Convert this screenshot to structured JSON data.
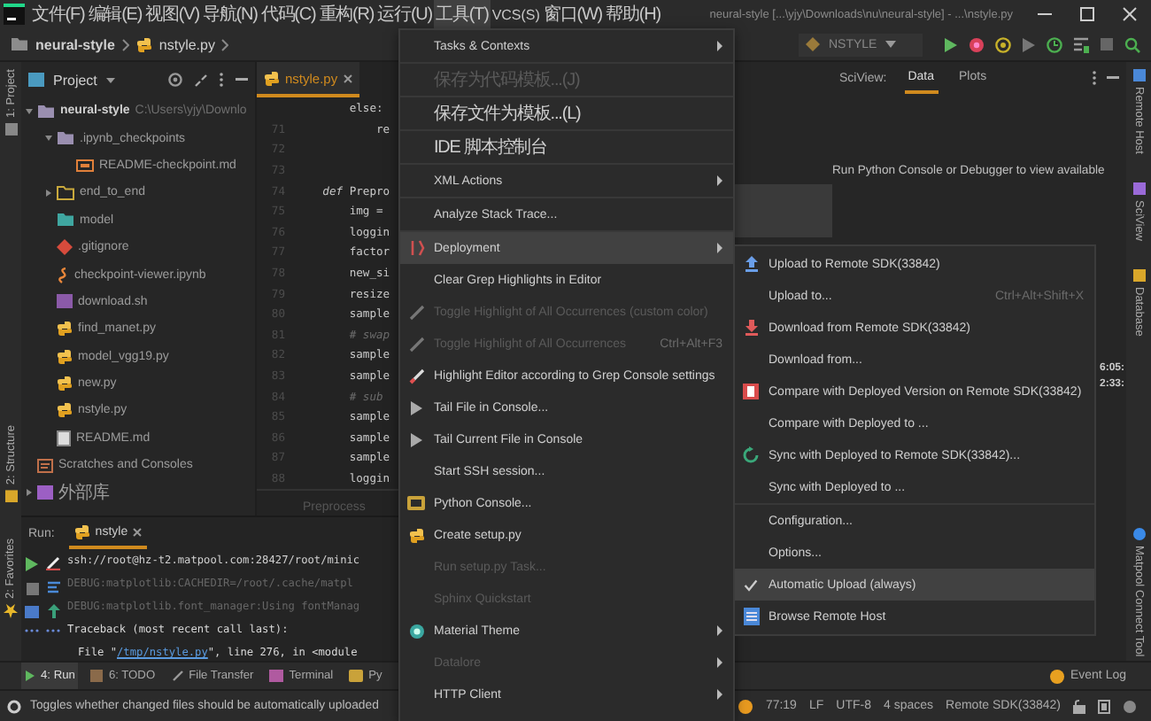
{
  "menu_bar": {
    "items": [
      {
        "label": "文件(F)",
        "selected": false
      },
      {
        "label": "编辑(E)",
        "selected": false
      },
      {
        "label": "视图(V)",
        "selected": false
      },
      {
        "label": "导航(N)",
        "selected": false
      },
      {
        "label": "代码(C)",
        "selected": false
      },
      {
        "label": "重构(R)",
        "selected": false
      },
      {
        "label": "运行(U)",
        "selected": false
      },
      {
        "label": "工具(T)",
        "selected": true
      },
      {
        "label": "VCS(S)",
        "selected": false
      },
      {
        "label": "窗口(W)",
        "selected": false
      },
      {
        "label": "帮助(H)",
        "selected": false
      }
    ],
    "title": "neural-style [...\\yjy\\Downloads\\nu\\neural-style] - ...\\nstyle.py"
  },
  "breadcrumb": [
    "neural-style",
    "nstyle.py"
  ],
  "run_config": "NSTYLE",
  "left_stripe": [
    "1: Project",
    "2: Structure",
    "2: Favorites"
  ],
  "project_panel": {
    "title": "Project",
    "tree": [
      {
        "label": "neural-style",
        "path": "C:\\Users\\yjy\\Downlo",
        "kind": "folder",
        "expanded": true,
        "children": [
          {
            "label": ".ipynb_checkpoints",
            "kind": "folder",
            "expanded": true,
            "children": [
              {
                "label": "README-checkpoint.md",
                "kind": "md"
              }
            ]
          },
          {
            "label": "end_to_end",
            "kind": "package",
            "expanded": false
          },
          {
            "label": "model",
            "kind": "module"
          },
          {
            "label": ".gitignore",
            "kind": "git"
          },
          {
            "label": "checkpoint-viewer.ipynb",
            "kind": "ipynb"
          },
          {
            "label": "download.sh",
            "kind": "sh"
          },
          {
            "label": "find_manet.py",
            "kind": "py"
          },
          {
            "label": "model_vgg19.py",
            "kind": "py"
          },
          {
            "label": "new.py",
            "kind": "py"
          },
          {
            "label": "nstyle.py",
            "kind": "py"
          },
          {
            "label": "README.md",
            "kind": "doc"
          }
        ]
      },
      {
        "label": "Scratches and Consoles",
        "kind": "scratch"
      },
      {
        "label": "外部库",
        "kind": "library",
        "expanded": false
      }
    ]
  },
  "editor": {
    "tab": "nstyle.py",
    "lines": [
      {
        "code": "        else:",
        "kind": "code"
      },
      {
        "number": "71",
        "code": "            re",
        "kind": "code"
      },
      {
        "number": "72"
      },
      {
        "number": "73"
      },
      {
        "number": "74",
        "code": "    *def* Prepro",
        "kind": "code"
      },
      {
        "number": "75",
        "code": "        img =",
        "kind": "code"
      },
      {
        "number": "76",
        "code": "        loggin",
        "kind": "code"
      },
      {
        "number": "77",
        "code": "        factor",
        "kind": "code"
      },
      {
        "number": "78",
        "code": "        new_si",
        "kind": "code"
      },
      {
        "number": "79",
        "code": "        resize",
        "kind": "code"
      },
      {
        "number": "80",
        "code": "        sample",
        "kind": "code"
      },
      {
        "number": "81",
        "code": "        # swap",
        "kind": "comment"
      },
      {
        "number": "82",
        "code": "        sample",
        "kind": "code"
      },
      {
        "number": "83",
        "code": "        sample",
        "kind": "code"
      },
      {
        "number": "84",
        "code": "        # sub",
        "kind": "comment"
      },
      {
        "number": "85",
        "code": "        sample",
        "kind": "code"
      },
      {
        "number": "86",
        "code": "        sample",
        "kind": "code"
      },
      {
        "number": "87",
        "code": "        sample",
        "kind": "code"
      },
      {
        "number": "88",
        "code": "        loggin",
        "kind": "code"
      }
    ],
    "footer": "Preprocess"
  },
  "sciview": {
    "label": "SciView:",
    "tabs": [
      {
        "label": "Data",
        "selected": true
      },
      {
        "label": "Plots",
        "selected": false
      }
    ],
    "message": "Run Python Console or Debugger to view available"
  },
  "log_times": [
    "6:05:",
    "2:33:"
  ],
  "right_stripe": [
    "Remote Host",
    "SciView",
    "Database",
    "Matpool Connect Tool"
  ],
  "run_panel": {
    "label": "Run:",
    "tab": "nstyle",
    "lines": [
      {
        "kind": "command",
        "text": "ssh://root@hz-t2.matpool.com:28427/root/minic"
      },
      {
        "kind": "debug",
        "text": "DEBUG:matplotlib:CACHEDIR=/root/.cache/matpl"
      },
      {
        "kind": "debug",
        "text": "DEBUG:matplotlib.font_manager:Using fontManag"
      },
      {
        "kind": "error",
        "text": "Traceback (most recent call last):"
      },
      {
        "kind": "trace",
        "before": "File \"",
        "link": "/tmp/nstyle.py",
        "after": "\", line 276, in <module"
      }
    ]
  },
  "bottom_tabs": [
    {
      "label": "4: Run",
      "selected": true
    },
    {
      "label": "6: TODO",
      "selected": false
    },
    {
      "label": "File Transfer",
      "selected": false
    },
    {
      "label": "Terminal",
      "selected": false
    },
    {
      "label": "Py",
      "selected": false
    }
  ],
  "event_log": "Event Log",
  "status_bar": {
    "message": "Toggles whether changed files should be automatically uploaded",
    "items": [
      "77:19",
      "LF",
      "UTF-8",
      "4 spaces",
      "Remote SDK(33842)"
    ]
  },
  "tools_menu": [
    {
      "label": "Tasks & Contexts",
      "selected": false,
      "disabled": false,
      "submenu": true,
      "separator_before": false
    },
    {
      "label": "保存为代码模板...(J)",
      "selected": false,
      "disabled": true,
      "submenu": false,
      "separator_before": true
    },
    {
      "label": "保存文件为模板...(L)",
      "selected": false,
      "disabled": false,
      "submenu": false,
      "separator_before": true
    },
    {
      "label": "IDE 脚本控制台",
      "selected": false,
      "disabled": false,
      "submenu": false,
      "separator_before": true
    },
    {
      "label": "XML Actions",
      "selected": false,
      "disabled": false,
      "submenu": true,
      "separator_before": true
    },
    {
      "label": "Analyze Stack Trace...",
      "selected": false,
      "disabled": false,
      "submenu": false,
      "separator_before": true
    },
    {
      "label": "Deployment",
      "selected": true,
      "disabled": false,
      "submenu": true,
      "separator_before": true
    },
    {
      "label": "Clear Grep Highlights in Editor",
      "selected": false,
      "disabled": false,
      "submenu": false,
      "separator_before": false
    },
    {
      "label": "Toggle Highlight of All Occurrences (custom color)",
      "selected": false,
      "disabled": true,
      "submenu": false,
      "separator_before": false
    },
    {
      "label": "Toggle Highlight of All Occurrences",
      "shortcut": "Ctrl+Alt+F3",
      "selected": false,
      "disabled": true,
      "submenu": false,
      "separator_before": false
    },
    {
      "label": "Highlight Editor according to Grep Console settings",
      "selected": false,
      "disabled": false,
      "submenu": false,
      "separator_before": false
    },
    {
      "label": "Tail File in Console...",
      "selected": false,
      "disabled": false,
      "submenu": false,
      "separator_before": false
    },
    {
      "label": "Tail Current File in Console",
      "selected": false,
      "disabled": false,
      "submenu": false,
      "separator_before": false
    },
    {
      "label": "Start SSH session...",
      "selected": false,
      "disabled": false,
      "submenu": false,
      "separator_before": false
    },
    {
      "label": "Python Console...",
      "selected": false,
      "disabled": false,
      "submenu": false,
      "separator_before": false
    },
    {
      "label": "Create setup.py",
      "selected": false,
      "disabled": false,
      "submenu": false,
      "separator_before": false
    },
    {
      "label": "Run setup.py Task...",
      "selected": false,
      "disabled": true,
      "submenu": false,
      "separator_before": false
    },
    {
      "label": "Sphinx Quickstart",
      "selected": false,
      "disabled": true,
      "submenu": false,
      "separator_before": false
    },
    {
      "label": "Material Theme",
      "selected": false,
      "disabled": false,
      "submenu": true,
      "separator_before": false
    },
    {
      "label": "Datalore",
      "selected": false,
      "disabled": true,
      "submenu": true,
      "separator_before": false
    },
    {
      "label": "HTTP Client",
      "selected": false,
      "disabled": false,
      "submenu": true,
      "separator_before": false
    }
  ],
  "deployment_menu": [
    {
      "label": "Upload to Remote SDK(33842)",
      "selected": false,
      "checked": false,
      "separator_before": false
    },
    {
      "label": "Upload to...",
      "shortcut": "Ctrl+Alt+Shift+X",
      "selected": false,
      "checked": false,
      "separator_before": false
    },
    {
      "label": "Download from Remote SDK(33842)",
      "selected": false,
      "checked": false,
      "separator_before": false
    },
    {
      "label": "Download from...",
      "selected": false,
      "checked": false,
      "separator_before": false
    },
    {
      "label": "Compare with Deployed Version on Remote SDK(33842)",
      "selected": false,
      "checked": false,
      "separator_before": false
    },
    {
      "label": "Compare with Deployed to ...",
      "selected": false,
      "checked": false,
      "separator_before": false
    },
    {
      "label": "Sync with Deployed to Remote SDK(33842)...",
      "selected": false,
      "checked": false,
      "separator_before": false
    },
    {
      "label": "Sync with Deployed to ...",
      "selected": false,
      "checked": false,
      "separator_before": false
    },
    {
      "label": "Configuration...",
      "selected": false,
      "checked": false,
      "separator_before": true
    },
    {
      "label": "Options...",
      "selected": false,
      "checked": false,
      "separator_before": false
    },
    {
      "label": "Automatic Upload (always)",
      "selected": true,
      "checked": true,
      "separator_before": false
    },
    {
      "label": "Browse Remote Host",
      "selected": false,
      "checked": false,
      "separator_before": false
    }
  ]
}
